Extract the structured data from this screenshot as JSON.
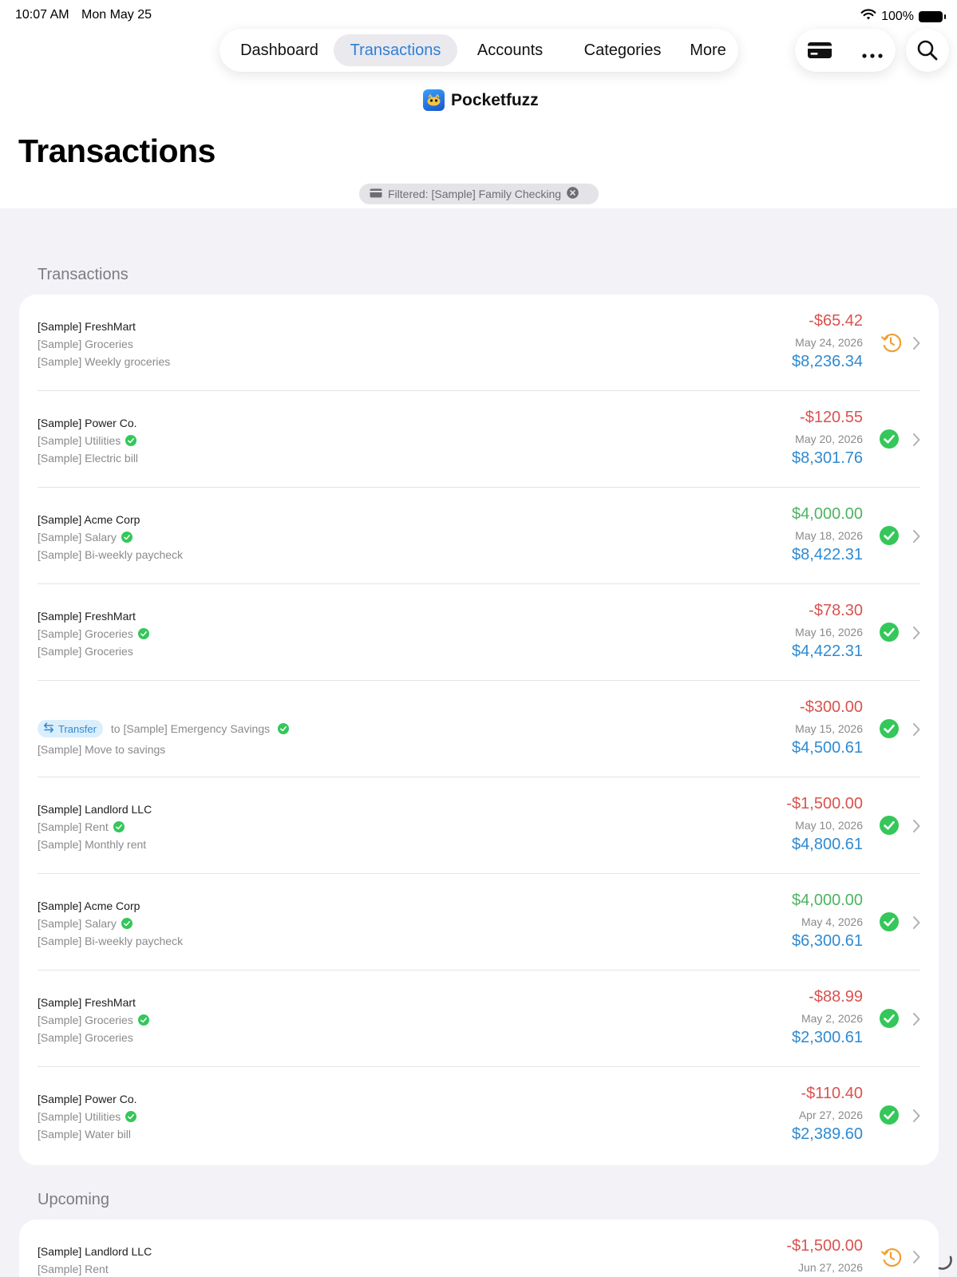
{
  "status_bar": {
    "time": "10:07 AM",
    "date": "Mon May 25",
    "battery": "100%"
  },
  "nav": {
    "tabs": [
      {
        "label": "Dashboard"
      },
      {
        "label": "Transactions"
      },
      {
        "label": "Accounts"
      },
      {
        "label": "Categories"
      },
      {
        "label": "More"
      }
    ],
    "active_tab": "Transactions",
    "actions": [
      "card-icon",
      "more-icon",
      "search-icon"
    ]
  },
  "brand": {
    "name": "Pocketfuzz"
  },
  "page": {
    "title": "Transactions",
    "filter_label": "Filtered: [Sample] Family Checking"
  },
  "colors": {
    "accent": "#2f7fd6",
    "negative": "#d9534f",
    "positive": "#4db460",
    "balance": "#2f8ad1",
    "cleared": "#34c759",
    "pending": "#f0a030"
  },
  "sections": {
    "transactions_header": "Transactions",
    "upcoming_header": "Upcoming"
  },
  "transactions": [
    {
      "payee": "[Sample] FreshMart",
      "category": "[Sample] Groceries",
      "category_cleared": false,
      "memo": "[Sample] Weekly groceries",
      "amount": "-$65.42",
      "sign": "neg",
      "date": "May 24, 2026",
      "balance": "$8,236.34",
      "status": "pending"
    },
    {
      "payee": "[Sample] Power Co.",
      "category": "[Sample] Utilities",
      "category_cleared": true,
      "memo": "[Sample] Electric bill",
      "amount": "-$120.55",
      "sign": "neg",
      "date": "May 20, 2026",
      "balance": "$8,301.76",
      "status": "cleared"
    },
    {
      "payee": "[Sample] Acme Corp",
      "category": "[Sample] Salary",
      "category_cleared": true,
      "memo": "[Sample] Bi-weekly paycheck",
      "amount": "$4,000.00",
      "sign": "pos",
      "date": "May 18, 2026",
      "balance": "$8,422.31",
      "status": "cleared"
    },
    {
      "payee": "[Sample] FreshMart",
      "category": "[Sample] Groceries",
      "category_cleared": true,
      "memo": "[Sample] Groceries",
      "amount": "-$78.30",
      "sign": "neg",
      "date": "May 16, 2026",
      "balance": "$4,422.31",
      "status": "cleared"
    },
    {
      "transfer": true,
      "transfer_label": "Transfer",
      "transfer_to": "to [Sample] Emergency Savings",
      "memo": "[Sample] Move to savings",
      "amount": "-$300.00",
      "sign": "neg",
      "date": "May 15, 2026",
      "balance": "$4,500.61",
      "status": "cleared"
    },
    {
      "payee": "[Sample] Landlord LLC",
      "category": "[Sample] Rent",
      "category_cleared": true,
      "memo": "[Sample] Monthly rent",
      "amount": "-$1,500.00",
      "sign": "neg",
      "date": "May 10, 2026",
      "balance": "$4,800.61",
      "status": "cleared"
    },
    {
      "payee": "[Sample] Acme Corp",
      "category": "[Sample] Salary",
      "category_cleared": true,
      "memo": "[Sample] Bi-weekly paycheck",
      "amount": "$4,000.00",
      "sign": "pos",
      "date": "May 4, 2026",
      "balance": "$6,300.61",
      "status": "cleared"
    },
    {
      "payee": "[Sample] FreshMart",
      "category": "[Sample] Groceries",
      "category_cleared": true,
      "memo": "[Sample] Groceries",
      "amount": "-$88.99",
      "sign": "neg",
      "date": "May 2, 2026",
      "balance": "$2,300.61",
      "status": "cleared"
    },
    {
      "payee": "[Sample] Power Co.",
      "category": "[Sample] Utilities",
      "category_cleared": true,
      "memo": "[Sample] Water bill",
      "amount": "-$110.40",
      "sign": "neg",
      "date": "Apr 27, 2026",
      "balance": "$2,389.60",
      "status": "cleared"
    }
  ],
  "upcoming": [
    {
      "payee": "[Sample] Landlord LLC",
      "category": "[Sample] Rent",
      "amount": "-$1,500.00",
      "sign": "neg",
      "date": "Jun 27, 2026",
      "status": "pending"
    }
  ]
}
